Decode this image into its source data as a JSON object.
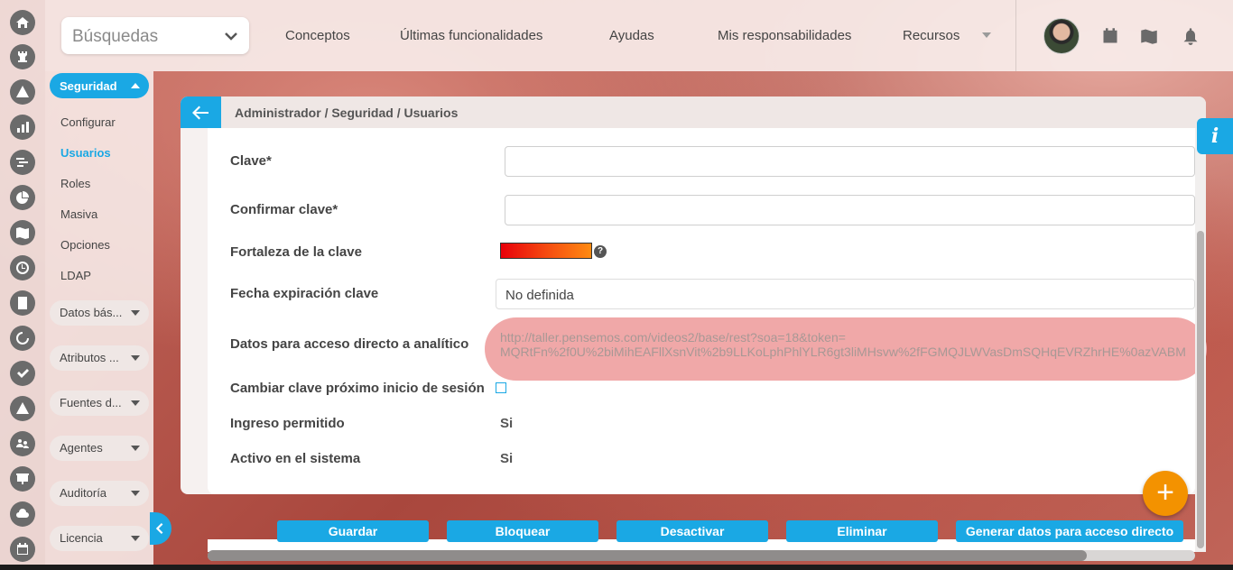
{
  "topbar": {
    "search_label": "Búsquedas",
    "nav": [
      "Conceptos",
      "Últimas funcionalidades",
      "Ayudas",
      "Mis responsabilidades",
      "Recursos"
    ]
  },
  "sidebar": {
    "section_label": "Seguridad",
    "items": [
      "Configurar",
      "Usuarios",
      "Roles",
      "Masiva",
      "Opciones",
      "LDAP"
    ],
    "active_item": "Usuarios",
    "groups": [
      "Datos bás...",
      "Atributos ...",
      "Fuentes d...",
      "Agentes",
      "Auditoría",
      "Licencia"
    ]
  },
  "panel": {
    "breadcrumb": "Administrador / Seguridad / Usuarios",
    "fields": {
      "clave_label": "Clave*",
      "clave_value": "",
      "confirmar_label": "Confirmar clave*",
      "confirmar_value": "",
      "fortaleza_label": "Fortaleza de la clave",
      "fortaleza_help": "?",
      "fecha_label": "Fecha expiración clave",
      "fecha_value": "No definida",
      "datos_label": "Datos para acceso directo a analítico",
      "datos_url_line1": "http://taller.pensemos.com/videos2/base/rest?soa=18&token=",
      "datos_url_line2": "MQRtFn%2f0U%2biMihEAFllXsnVit%2b9LLKoLphPhlYLR6gt3liMHsvw%2fFGMQJLWVasDmSQHqEVRZhrHE%0azVABM",
      "cambiar_label": "Cambiar clave próximo inicio de sesión",
      "cambiar_checked": false,
      "ingreso_label": "Ingreso permitido",
      "ingreso_value": "Si",
      "activo_label": "Activo en el sistema",
      "activo_value": "Si"
    }
  },
  "actions": [
    "Guardar",
    "Bloquear",
    "Desactivar",
    "Eliminar",
    "Generar datos para acceso directo"
  ],
  "info_label": "i",
  "fab_label": "+",
  "colors": {
    "accent": "#1aa8e4",
    "fab": "#f39200",
    "highlight": "#f0a8a8"
  }
}
